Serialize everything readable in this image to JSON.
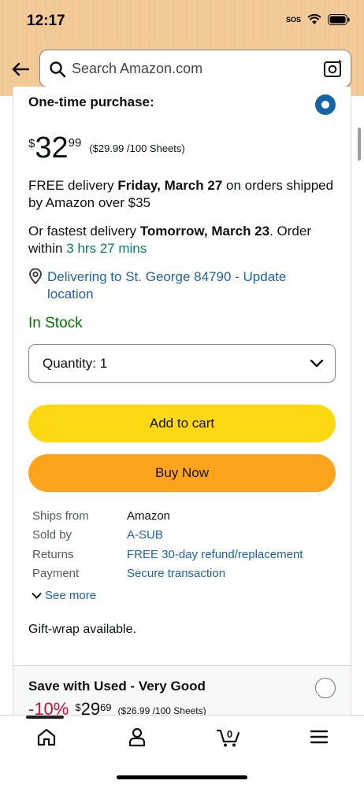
{
  "status": {
    "time": "12:17",
    "sos": "SOS"
  },
  "search": {
    "placeholder": "Search Amazon.com"
  },
  "purchase": {
    "title": "One-time purchase:",
    "price_symbol": "$",
    "price_whole": "32",
    "price_fraction": "99",
    "unit_price": "($29.99 /100 Sheets)",
    "delivery_prefix": "FREE delivery ",
    "delivery_date": "Friday, March 27",
    "delivery_suffix": " on orders shipped",
    "delivery_line2": "by Amazon over $35",
    "fastest_prefix": "Or fastest delivery ",
    "fastest_date": "Tomorrow, March 23",
    "fastest_suffix": ". Order",
    "within": "within ",
    "countdown": "3 hrs 27 mins",
    "location_line1": "Delivering to St. George 84790 - Update",
    "location_line2": "location",
    "stock": "In Stock",
    "quantity": "Quantity: 1",
    "add_to_cart": "Add to cart",
    "buy_now": "Buy Now"
  },
  "details": [
    {
      "label": "Ships from",
      "value": "Amazon",
      "link": false
    },
    {
      "label": "Sold by",
      "value": "A-SUB",
      "link": true
    },
    {
      "label": "Returns",
      "value": "FREE 30-day refund/replacement",
      "link": true
    },
    {
      "label": "Payment",
      "value": "Secure transaction",
      "link": true
    }
  ],
  "see_more": "See more",
  "gift_wrap": "Gift-wrap available.",
  "used": {
    "title": "Save with Used - Very Good",
    "discount": "-10%",
    "price_symbol": "$",
    "price_whole": "29",
    "price_fraction": "69",
    "unit_price": "($26.99 /100 Sheets)"
  },
  "nav": {
    "items": [
      "home-icon",
      "account-icon",
      "cart-icon",
      "menu-icon"
    ],
    "cart_count": "0"
  },
  "colors": {
    "header": "#f2c894",
    "link": "#2162a1",
    "in_stock": "#007600",
    "add_to_cart": "#ffd814",
    "buy_now": "#ffa41c",
    "discount": "#cc0c39"
  }
}
